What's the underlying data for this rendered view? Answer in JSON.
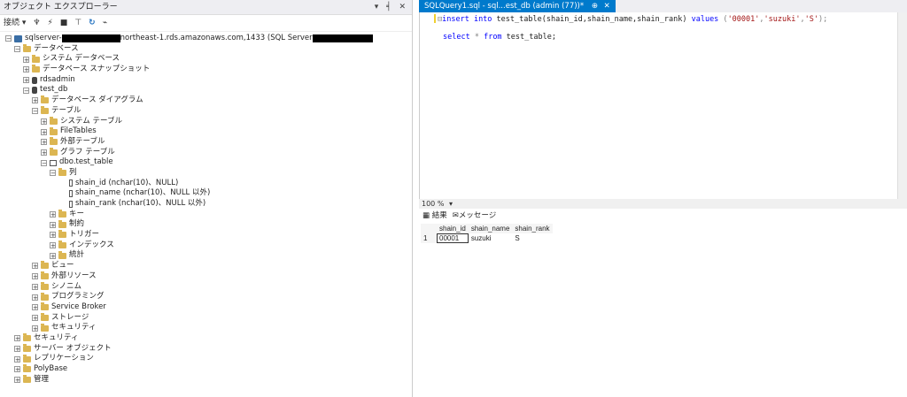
{
  "object_explorer": {
    "title": "オブジェクト エクスプローラー",
    "title_controls": "▾ ╡ ✕",
    "toolbar": {
      "connect_label": "接続 ▾",
      "icons": [
        "connect-plug-icon",
        "disconnect-icon",
        "stop-icon",
        "filter-icon",
        "refresh-icon",
        "activity-monitor-icon"
      ]
    },
    "server": {
      "prefix": "sqlserver-",
      "middle": "northeast-1.rds.amazonaws.com,1433 (SQL Server"
    },
    "tree": [
      {
        "level": 1,
        "exp": "⊟",
        "icon": "folder",
        "label": "データベース"
      },
      {
        "level": 2,
        "exp": "⊞",
        "icon": "folder",
        "label": "システム データベース"
      },
      {
        "level": 2,
        "exp": "⊞",
        "icon": "folder",
        "label": "データベース スナップショット"
      },
      {
        "level": 2,
        "exp": "⊞",
        "icon": "db",
        "label": "rdsadmin"
      },
      {
        "level": 2,
        "exp": "⊟",
        "icon": "db",
        "label": "test_db"
      },
      {
        "level": 3,
        "exp": "⊞",
        "icon": "folder",
        "label": "データベース ダイアグラム"
      },
      {
        "level": 3,
        "exp": "⊟",
        "icon": "folder",
        "label": "テーブル"
      },
      {
        "level": 4,
        "exp": "⊞",
        "icon": "folder",
        "label": "システム テーブル"
      },
      {
        "level": 4,
        "exp": "⊞",
        "icon": "folder",
        "label": "FileTables"
      },
      {
        "level": 4,
        "exp": "⊞",
        "icon": "folder",
        "label": "外部テーブル"
      },
      {
        "level": 4,
        "exp": "⊞",
        "icon": "folder",
        "label": "グラフ テーブル"
      },
      {
        "level": 4,
        "exp": "⊟",
        "icon": "table",
        "label": "dbo.test_table"
      },
      {
        "level": 5,
        "exp": "⊟",
        "icon": "folder",
        "label": "列"
      },
      {
        "level": 6,
        "exp": "",
        "icon": "col",
        "label": "shain_id (nchar(10)、NULL)"
      },
      {
        "level": 6,
        "exp": "",
        "icon": "col",
        "label": "shain_name (nchar(10)、NULL 以外)"
      },
      {
        "level": 6,
        "exp": "",
        "icon": "col",
        "label": "shain_rank (nchar(10)、NULL 以外)"
      },
      {
        "level": 5,
        "exp": "⊞",
        "icon": "folder",
        "label": "キー"
      },
      {
        "level": 5,
        "exp": "⊞",
        "icon": "folder",
        "label": "制約"
      },
      {
        "level": 5,
        "exp": "⊞",
        "icon": "folder",
        "label": "トリガー"
      },
      {
        "level": 5,
        "exp": "⊞",
        "icon": "folder",
        "label": "インデックス"
      },
      {
        "level": 5,
        "exp": "⊞",
        "icon": "folder",
        "label": "統計"
      },
      {
        "level": 3,
        "exp": "⊞",
        "icon": "folder",
        "label": "ビュー"
      },
      {
        "level": 3,
        "exp": "⊞",
        "icon": "folder",
        "label": "外部リソース"
      },
      {
        "level": 3,
        "exp": "⊞",
        "icon": "folder",
        "label": "シノニム"
      },
      {
        "level": 3,
        "exp": "⊞",
        "icon": "folder",
        "label": "プログラミング"
      },
      {
        "level": 3,
        "exp": "⊞",
        "icon": "folder",
        "label": "Service Broker"
      },
      {
        "level": 3,
        "exp": "⊞",
        "icon": "folder",
        "label": "ストレージ"
      },
      {
        "level": 3,
        "exp": "⊞",
        "icon": "folder",
        "label": "セキュリティ"
      },
      {
        "level": 1,
        "exp": "⊞",
        "icon": "folder",
        "label": "セキュリティ"
      },
      {
        "level": 1,
        "exp": "⊞",
        "icon": "folder",
        "label": "サーバー オブジェクト"
      },
      {
        "level": 1,
        "exp": "⊞",
        "icon": "folder",
        "label": "レプリケーション"
      },
      {
        "level": 1,
        "exp": "⊞",
        "icon": "folder",
        "label": "PolyBase"
      },
      {
        "level": 1,
        "exp": "⊞",
        "icon": "folder",
        "label": "管理"
      }
    ]
  },
  "query_tab": {
    "label": "SQLQuery1.sql - sql...est_db (admin (77))*",
    "pin": "⊕",
    "close": "✕"
  },
  "editor": {
    "line1": {
      "kw1": "insert into",
      "text": " test_table(shain_id,shain_name,shain_rank) ",
      "kw2": "values",
      "open": " (",
      "v1": "'00001'",
      "v2": "'suzuki'",
      "v3": "'S'",
      "close": ");"
    },
    "line2": {
      "kw1": "select",
      "star": " * ",
      "kw2": "from",
      "text": " test_table;"
    }
  },
  "zoom": {
    "level": "100 %",
    "arrow": "▾"
  },
  "results_tabs": {
    "results": "結果",
    "messages": "メッセージ"
  },
  "results_grid": {
    "columns": [
      "shain_id",
      "shain_name",
      "shain_rank"
    ],
    "rows": [
      {
        "num": "1",
        "cells": [
          "00001",
          "suzuki",
          "S"
        ]
      }
    ]
  },
  "colors": {
    "tab_accent": "#007acc",
    "folder": "#dcb652",
    "keyword": "#0000ff",
    "string": "#a31515"
  }
}
